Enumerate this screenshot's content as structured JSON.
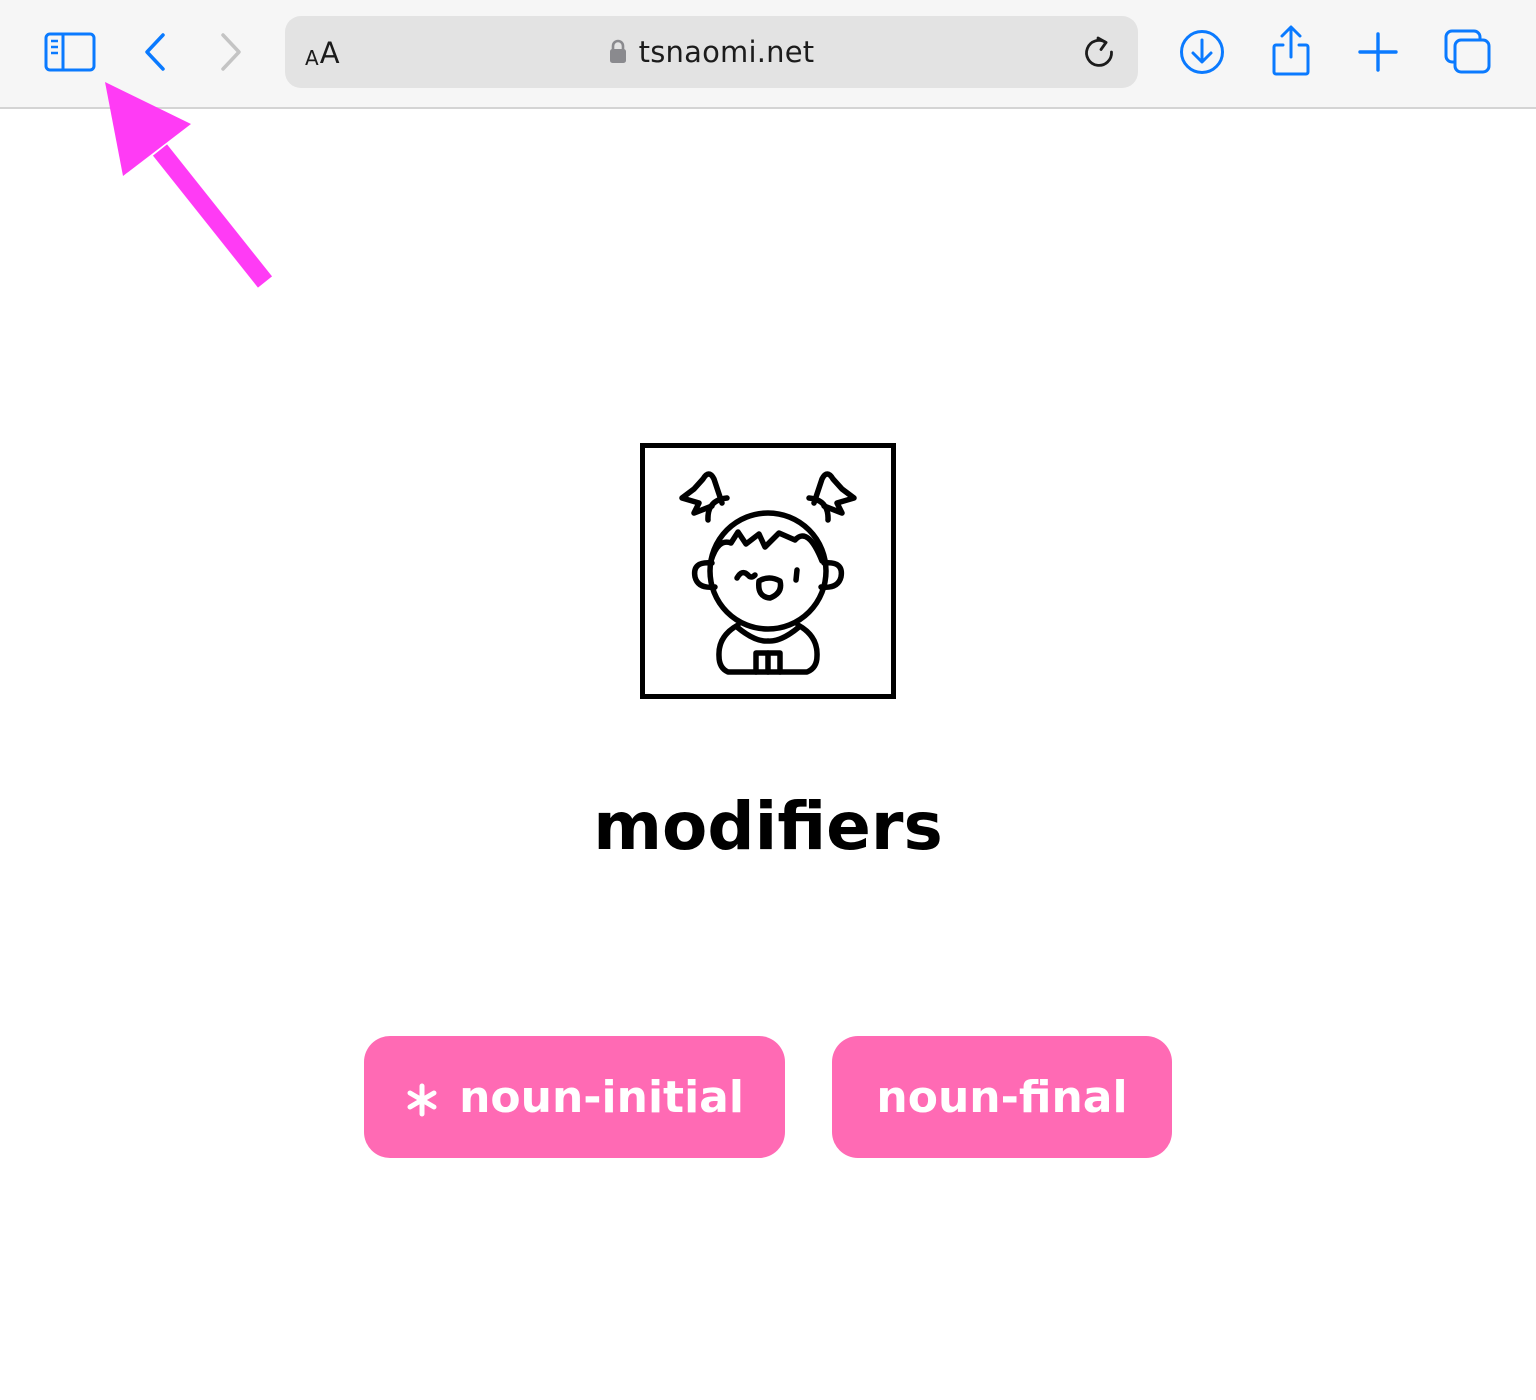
{
  "browser": {
    "reader_small_label": "A",
    "reader_big_label": "A",
    "url": "tsnaomi.net",
    "accent_color": "#0a7aff",
    "icons": [
      "sidebar-icon",
      "back-icon",
      "forward-icon",
      "lock-icon",
      "reload-icon",
      "download-icon",
      "share-icon",
      "new-tab-icon",
      "tabs-icon"
    ]
  },
  "annotation": {
    "color": "#ff3bf5",
    "points_to": "sidebar-icon"
  },
  "main": {
    "avatar_icon": "girl-avatar-icon",
    "title": "modifiers",
    "options": [
      {
        "label": "noun-initial",
        "marker_icon": "asterisk-icon"
      },
      {
        "label": "noun-final"
      }
    ],
    "button_color": "#ff6ab4"
  }
}
